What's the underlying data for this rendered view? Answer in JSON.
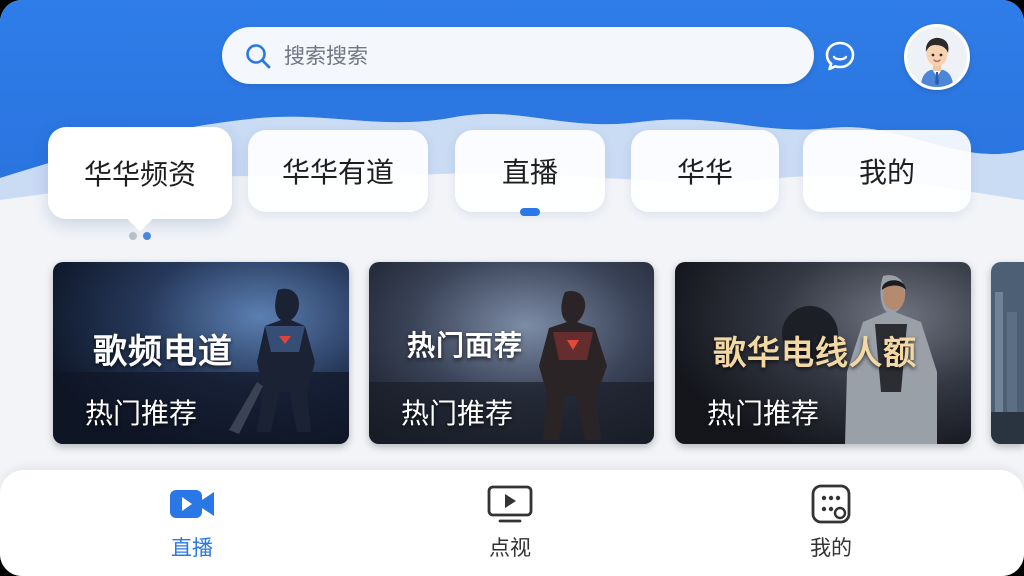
{
  "search": {
    "placeholder": "搜索搜索"
  },
  "header": {
    "message_icon": "chat-bubble-icon",
    "avatar_icon": "user-avatar"
  },
  "tabs": [
    {
      "label": "华华频资",
      "active": false,
      "bubble": true
    },
    {
      "label": "华华有道",
      "active": false
    },
    {
      "label": "直播",
      "active": true
    },
    {
      "label": "华华",
      "active": false
    },
    {
      "label": "我的",
      "active": false
    }
  ],
  "page_indicator": {
    "count": 2,
    "current": 2
  },
  "cards": [
    {
      "title": "歌频电道",
      "subtitle": "热门推荐",
      "title_color": "#ffffff"
    },
    {
      "title": "热门面荐",
      "subtitle": "热门推荐",
      "title_color": "#ffffff"
    },
    {
      "title": "歌华电线人额",
      "subtitle": "热门推荐",
      "title_color": "#f3d8a4"
    }
  ],
  "bottom_nav": [
    {
      "label": "直播",
      "icon": "video-camera-icon",
      "active": true
    },
    {
      "label": "点视",
      "icon": "play-screen-icon",
      "active": false
    },
    {
      "label": "我的",
      "icon": "apps-grid-icon",
      "active": false
    }
  ],
  "colors": {
    "header_blue": "#2a78e6",
    "accent": "#2a78e6",
    "background": "#f2f4f8"
  }
}
